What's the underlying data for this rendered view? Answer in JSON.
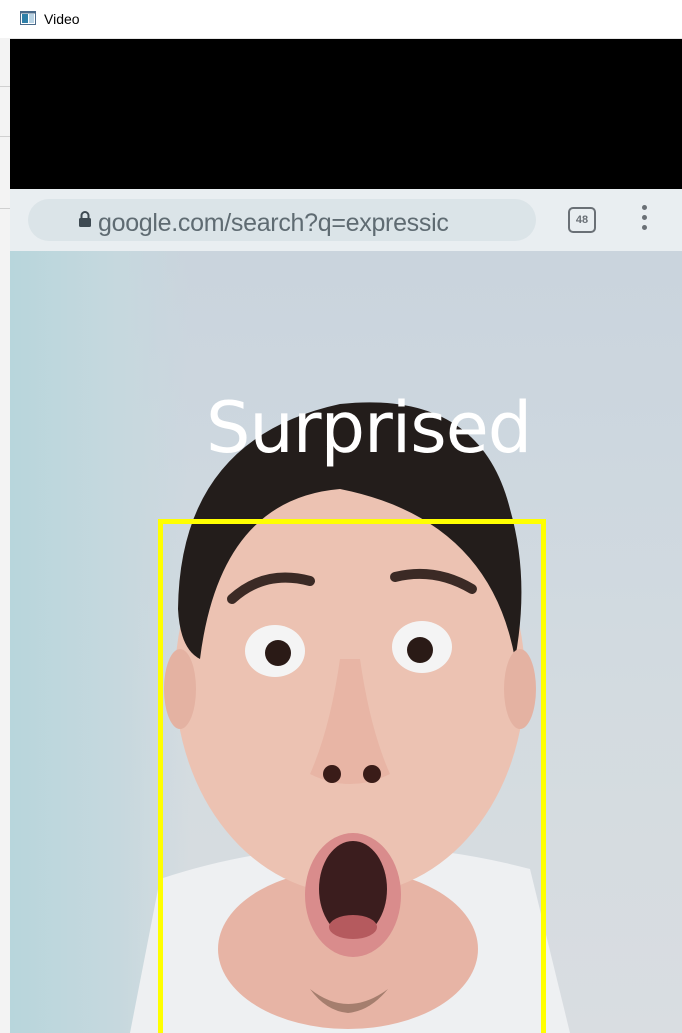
{
  "window": {
    "title": "Video"
  },
  "browser": {
    "url": "google.com/search?q=expressic",
    "tab_count": "48"
  },
  "detection": {
    "emotion_label": "Surprised",
    "box_color": "#ffff00"
  },
  "icons": {
    "window_icon": "window-app-icon",
    "lock": "lock-icon",
    "tabs": "tabs-count-icon",
    "menu": "more-vert-icon"
  }
}
